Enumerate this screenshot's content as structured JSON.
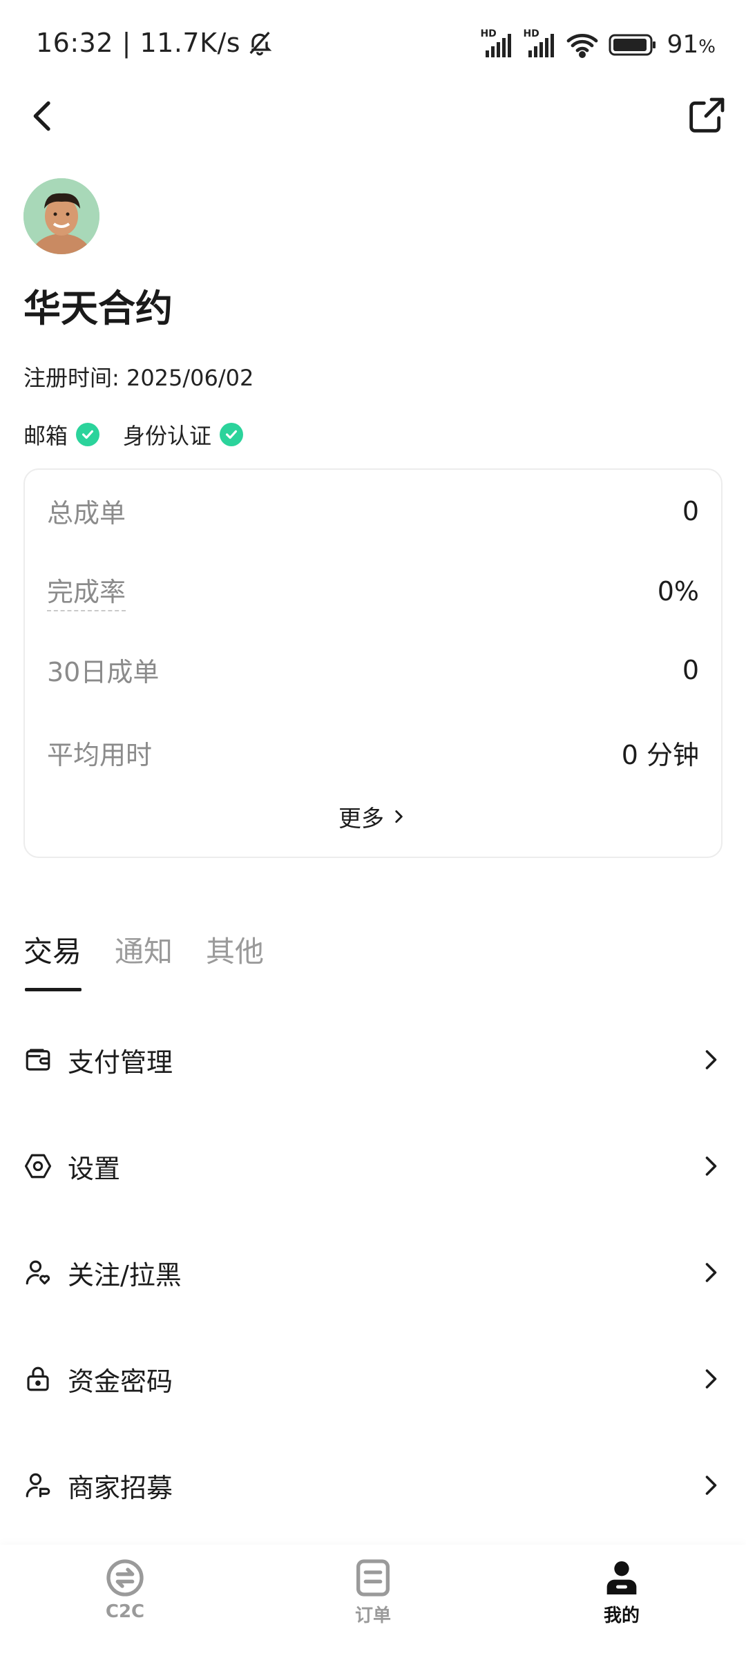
{
  "status_bar": {
    "time_speed": "16:32 | 11.7K/s",
    "network_badge_1": "HD",
    "network_badge_2": "HD",
    "battery": "91",
    "battery_unit": "%"
  },
  "profile": {
    "name": "华天合约",
    "registration": "注册时间: 2025/06/02",
    "verifications": [
      {
        "label": "邮箱"
      },
      {
        "label": "身份认证"
      }
    ]
  },
  "stats": {
    "rows": [
      {
        "label": "总成单",
        "value": "0"
      },
      {
        "label": "完成率",
        "value": "0%"
      },
      {
        "label": "30日成单",
        "value": "0"
      },
      {
        "label": "平均用时",
        "value": "0 分钟"
      }
    ],
    "more_label": "更多"
  },
  "tabs": [
    {
      "label": "交易",
      "active": true
    },
    {
      "label": "通知",
      "active": false
    },
    {
      "label": "其他",
      "active": false
    }
  ],
  "menu": [
    {
      "label": "支付管理",
      "icon": "wallet-icon"
    },
    {
      "label": "设置",
      "icon": "settings-icon"
    },
    {
      "label": "关注/拉黑",
      "icon": "user-heart-icon"
    },
    {
      "label": "资金密码",
      "icon": "lock-icon"
    },
    {
      "label": "商家招募",
      "icon": "merchant-icon"
    }
  ],
  "bottom_nav": [
    {
      "label": "C2C",
      "icon": "c2c-icon",
      "active": false
    },
    {
      "label": "订单",
      "icon": "order-icon",
      "active": false
    },
    {
      "label": "我的",
      "icon": "profile-icon",
      "active": true
    }
  ],
  "colors": {
    "verified_green": "#2bd39b",
    "muted_text": "#8b8b8b",
    "primary_text": "#1c1c1c"
  }
}
